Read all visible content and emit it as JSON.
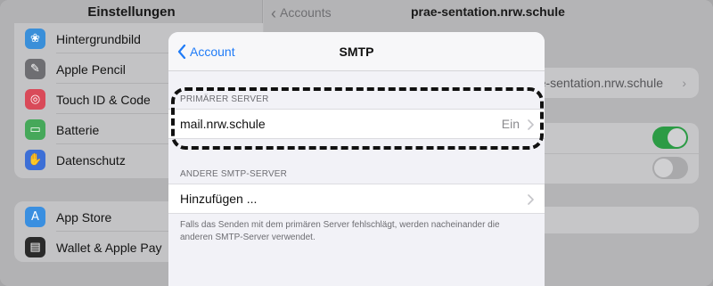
{
  "sidebar": {
    "title": "Einstellungen",
    "items": [
      {
        "label": "Hintergrundbild",
        "icon": "wallpaper-icon",
        "color": "#3a8fd9"
      },
      {
        "label": "Apple Pencil",
        "icon": "pencil-icon",
        "color": "#6e6e72"
      },
      {
        "label": "Touch ID & Code",
        "icon": "fingerprint-icon",
        "color": "#d94a59"
      },
      {
        "label": "Batterie",
        "icon": "battery-icon",
        "color": "#46a85a"
      },
      {
        "label": "Datenschutz",
        "icon": "hand-icon",
        "color": "#3d6fd6"
      }
    ],
    "items2": [
      {
        "label": "App Store",
        "icon": "appstore-icon",
        "color": "#3a8fe0"
      },
      {
        "label": "Wallet & Apple Pay",
        "icon": "wallet-icon",
        "color": "#2a2a2a"
      }
    ]
  },
  "detail": {
    "back_label": "Accounts",
    "title": "prae-sentation.nrw.schule",
    "server_value": "prae-sentation.nrw.schule",
    "toggle1_on": true,
    "toggle2_on": false
  },
  "sheet": {
    "back_label": "Account",
    "title": "SMTP",
    "primary_header": "PRIMÄRER SERVER",
    "primary_server": "mail.nrw.schule",
    "primary_status": "Ein",
    "other_header": "ANDERE SMTP-SERVER",
    "add_label": "Hinzufügen ...",
    "footnote": "Falls das Senden mit dem primären Server fehlschlägt, werden nacheinander die anderen SMTP-Server verwendet."
  },
  "colors": {
    "accent": "#1f7bf7",
    "toggle_on": "#2c9b45",
    "highlight": "#111111"
  }
}
